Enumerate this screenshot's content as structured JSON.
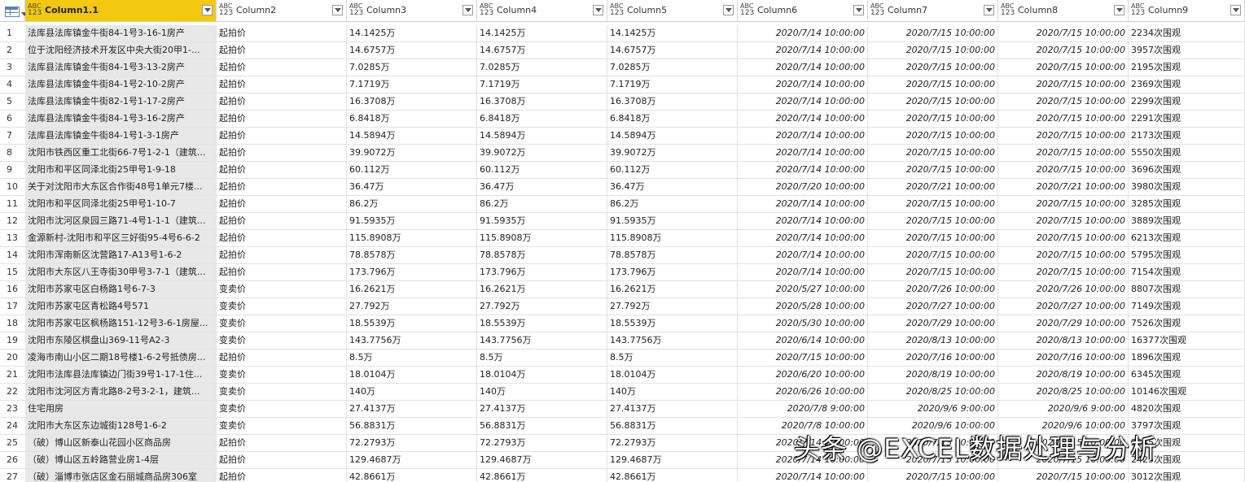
{
  "header": {
    "columns": [
      {
        "type_top": "ABC",
        "type_bottom": "123",
        "label": "Column1.1"
      },
      {
        "type_top": "ABC",
        "type_bottom": "123",
        "label": "Column2"
      },
      {
        "type_top": "ABC",
        "type_bottom": "123",
        "label": "Column3"
      },
      {
        "type_top": "ABC",
        "type_bottom": "123",
        "label": "Column4"
      },
      {
        "type_top": "ABC",
        "type_bottom": "123",
        "label": "Column5"
      },
      {
        "type_top": "ABC",
        "type_bottom": "123",
        "label": "Column6"
      },
      {
        "type_top": "ABC",
        "type_bottom": "123",
        "label": "Column7"
      },
      {
        "type_top": "ABC",
        "type_bottom": "123",
        "label": "Column8"
      },
      {
        "type_top": "ABC",
        "type_bottom": "123",
        "label": "Column9"
      }
    ]
  },
  "rows": [
    [
      "1",
      "法库县法库镇金牛街84-1号3-16-1房产",
      "起拍价",
      "14.1425万",
      "14.1425万",
      "14.1425万",
      "2020/7/14 10:00:00",
      "2020/7/15 10:00:00",
      "2020/7/15 10:00:00",
      "2234次围观"
    ],
    [
      "2",
      "位于沈阳经济技术开发区中央大街20甲1-...",
      "起拍价",
      "14.6757万",
      "14.6757万",
      "14.6757万",
      "2020/7/14 10:00:00",
      "2020/7/15 10:00:00",
      "2020/7/15 10:00:00",
      "3957次围观"
    ],
    [
      "3",
      "法库县法库镇金牛街84-1号3-13-2房产",
      "起拍价",
      "7.0285万",
      "7.0285万",
      "7.0285万",
      "2020/7/14 10:00:00",
      "2020/7/15 10:00:00",
      "2020/7/15 10:00:00",
      "2195次围观"
    ],
    [
      "4",
      "法库县法库镇金牛街84-1号2-10-2房产",
      "起拍价",
      "7.1719万",
      "7.1719万",
      "7.1719万",
      "2020/7/14 10:00:00",
      "2020/7/15 10:00:00",
      "2020/7/15 10:00:00",
      "2369次围观"
    ],
    [
      "5",
      "法库县法库镇金牛街82-1号1-17-2房产",
      "起拍价",
      "16.3708万",
      "16.3708万",
      "16.3708万",
      "2020/7/14 10:00:00",
      "2020/7/15 10:00:00",
      "2020/7/15 10:00:00",
      "2299次围观"
    ],
    [
      "6",
      "法库县法库镇金牛街84-1号3-16-2房产",
      "起拍价",
      "6.8418万",
      "6.8418万",
      "6.8418万",
      "2020/7/14 10:00:00",
      "2020/7/15 10:00:00",
      "2020/7/15 10:00:00",
      "2291次围观"
    ],
    [
      "7",
      "法库县法库镇金牛街84-1号1-3-1房产",
      "起拍价",
      "14.5894万",
      "14.5894万",
      "14.5894万",
      "2020/7/14 10:00:00",
      "2020/7/15 10:00:00",
      "2020/7/15 10:00:00",
      "2173次围观"
    ],
    [
      "8",
      "沈阳市铁西区重工北街66-7号1-2-1（建筑...",
      "起拍价",
      "39.9072万",
      "39.9072万",
      "39.9072万",
      "2020/7/14 10:00:00",
      "2020/7/15 10:00:00",
      "2020/7/15 10:00:00",
      "5550次围观"
    ],
    [
      "9",
      "沈阳市和平区同泽北街25甲号1-9-18",
      "起拍价",
      "60.112万",
      "60.112万",
      "60.112万",
      "2020/7/14 10:00:00",
      "2020/7/15 10:00:00",
      "2020/7/15 10:00:00",
      "3696次围观"
    ],
    [
      "10",
      "关于对沈阳市大东区合作街48号1单元7楼...",
      "起拍价",
      "36.47万",
      "36.47万",
      "36.47万",
      "2020/7/20 10:00:00",
      "2020/7/21 10:00:00",
      "2020/7/21 10:00:00",
      "3980次围观"
    ],
    [
      "11",
      "沈阳市和平区同泽北街25甲号1-10-7",
      "起拍价",
      "86.2万",
      "86.2万",
      "86.2万",
      "2020/7/14 10:00:00",
      "2020/7/15 10:00:00",
      "2020/7/15 10:00:00",
      "3285次围观"
    ],
    [
      "12",
      "沈阳市沈河区泉园三路71-4号1-1-1（建筑...",
      "起拍价",
      "91.5935万",
      "91.5935万",
      "91.5935万",
      "2020/7/14 10:00:00",
      "2020/7/15 10:00:00",
      "2020/7/15 10:00:00",
      "3889次围观"
    ],
    [
      "13",
      "金源新村-沈阳市和平区三好街95-4号6-6-2",
      "起拍价",
      "115.8908万",
      "115.8908万",
      "115.8908万",
      "2020/7/14 10:00:00",
      "2020/7/15 10:00:00",
      "2020/7/15 10:00:00",
      "6213次围观"
    ],
    [
      "14",
      "沈阳市浑南新区沈营路17-A13号1-6-2",
      "起拍价",
      "78.8578万",
      "78.8578万",
      "78.8578万",
      "2020/7/14 10:00:00",
      "2020/7/15 10:00:00",
      "2020/7/15 10:00:00",
      "5795次围观"
    ],
    [
      "15",
      "沈阳市大东区八王寺街30甲号3-7-1（建筑...",
      "起拍价",
      "173.796万",
      "173.796万",
      "173.796万",
      "2020/7/14 10:00:00",
      "2020/7/15 10:00:00",
      "2020/7/15 10:00:00",
      "7154次围观"
    ],
    [
      "16",
      "沈阳市苏家屯区白杨路1号6-7-3",
      "变卖价",
      "16.2621万",
      "16.2621万",
      "16.2621万",
      "2020/5/27 10:00:00",
      "2020/7/26 10:00:00",
      "2020/7/26 10:00:00",
      "8807次围观"
    ],
    [
      "17",
      "沈阳市苏家屯区青松路4号571",
      "变卖价",
      "27.792万",
      "27.792万",
      "27.792万",
      "2020/5/28 10:00:00",
      "2020/7/27 10:00:00",
      "2020/7/27 10:00:00",
      "7149次围观"
    ],
    [
      "18",
      "沈阳市苏家屯区枫杨路151-12号3-6-1房屋...",
      "变卖价",
      "18.5539万",
      "18.5539万",
      "18.5539万",
      "2020/5/30 10:00:00",
      "2020/7/29 10:00:00",
      "2020/7/29 10:00:00",
      "7526次围观"
    ],
    [
      "19",
      "沈阳市东陵区棋盘山369-11号A2-3",
      "变卖价",
      "143.7756万",
      "143.7756万",
      "143.7756万",
      "2020/6/14 10:00:00",
      "2020/8/13 10:00:00",
      "2020/8/13 10:00:00",
      "16377次围观"
    ],
    [
      "20",
      "凌海市南山小区二期18号楼1-6-2号抵债房...",
      "起拍价",
      "8.5万",
      "8.5万",
      "8.5万",
      "2020/7/15 10:00:00",
      "2020/7/16 10:00:00",
      "2020/7/16 10:00:00",
      "1896次围观"
    ],
    [
      "21",
      "沈阳市法库县法库镇边门街39号1-17-1住...",
      "变卖价",
      "18.0104万",
      "18.0104万",
      "18.0104万",
      "2020/6/20 10:00:00",
      "2020/8/19 10:00:00",
      "2020/8/19 10:00:00",
      "6345次围观"
    ],
    [
      "22",
      "沈阳市沈河区方青北路8-2号3-2-1，建筑...",
      "变卖价",
      "140万",
      "140万",
      "140万",
      "2020/6/26 10:00:00",
      "2020/8/25 10:00:00",
      "2020/8/25 10:00:00",
      "10146次围观"
    ],
    [
      "23",
      "住宅用房",
      "变卖价",
      "27.4137万",
      "27.4137万",
      "27.4137万",
      "2020/7/8 9:00:00",
      "2020/9/6 9:00:00",
      "2020/9/6 9:00:00",
      "4820次围观"
    ],
    [
      "24",
      "沈阳市大东区东边城街128号1-6-2",
      "变卖价",
      "56.8831万",
      "56.8831万",
      "56.8831万",
      "2020/7/8 10:00:00",
      "2020/9/6 10:00:00",
      "2020/9/6 10:00:00",
      "3797次围观"
    ],
    [
      "25",
      "（破）博山区新泰山花园小区商品房",
      "起拍价",
      "72.2793万",
      "72.2793万",
      "72.2793万",
      "2020/7/14 10:00:00",
      "2020/7/15 10:00:00",
      "2020/7/15 10:00:00",
      "2345次围观"
    ],
    [
      "26",
      "（破）博山区五岭路营业房1-4层",
      "起拍价",
      "129.4687万",
      "129.4687万",
      "129.4687万",
      "2020/7/14 10:00:00",
      "2020/7/15 10:00:00",
      "2020/7/15 10:00:00",
      "2425次围观"
    ],
    [
      "27",
      "（破）淄博市张店区金石丽城商品房306室",
      "起拍价",
      "42.8661万",
      "42.8661万",
      "42.8661万",
      "2020/7/14 10:00:00",
      "2020/7/15 10:00:00",
      "2020/7/15 10:00:00",
      "3012次围观"
    ]
  ],
  "watermark": "头条 @EXCEL数据处理与分析",
  "colors": {
    "active_header": "#f2c811",
    "col1_bg": "#e8e8e8"
  }
}
